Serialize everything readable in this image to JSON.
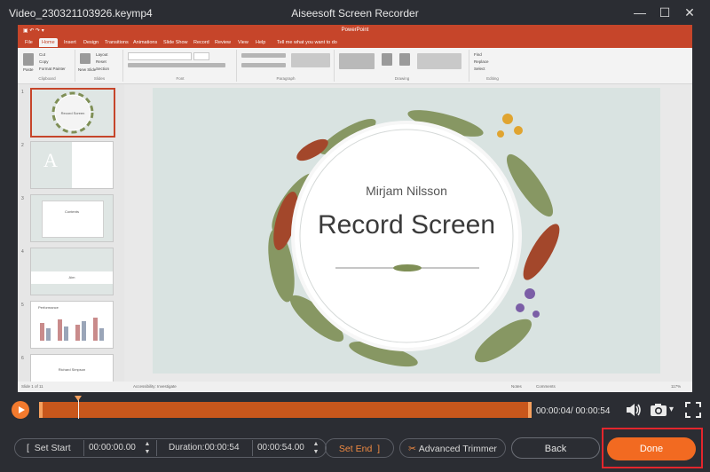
{
  "window": {
    "file_name": "Video_230321103926.keymp4",
    "app_title": "Aiseesoft Screen Recorder",
    "min": "—",
    "max": "☐",
    "close": "✕"
  },
  "ppt": {
    "title": "PowerPoint",
    "tabs": [
      "File",
      "Home",
      "Insert",
      "Design",
      "Transitions",
      "Animations",
      "Slide Show",
      "Record",
      "Review",
      "View",
      "Help",
      "Tell me what you want to do"
    ],
    "groups": [
      "Clipboard",
      "Slides",
      "Font",
      "Paragraph",
      "Drawing",
      "Editing"
    ],
    "clipboard_items": [
      "Paste",
      "Cut",
      "Copy",
      "Format Painter"
    ],
    "slides_items": [
      "New Slide",
      "Layout",
      "Reset",
      "Section"
    ],
    "editing_items": [
      "Find",
      "Replace",
      "Select"
    ],
    "thumbs": [
      {
        "num": "1",
        "text": "Record Screen"
      },
      {
        "num": "2",
        "text": "A"
      },
      {
        "num": "3",
        "text": "Contents"
      },
      {
        "num": "4",
        "text": "Aim"
      },
      {
        "num": "5",
        "text": "Performance"
      },
      {
        "num": "6",
        "text": "Richard Simpson"
      }
    ],
    "slide": {
      "author": "Mirjam Nilsson",
      "title": "Record Screen"
    },
    "status_left": "Slide 1 of 11",
    "status_accessibility": "Accessibility: Investigate",
    "status_notes": "Notes",
    "status_comments": "Comments",
    "status_zoom": "117%"
  },
  "player": {
    "timecode": "00:00:04/ 00:00:54"
  },
  "trimmer": {
    "set_start": "Set Start",
    "start_time": "00:00:00.00",
    "duration": "Duration:00:00:54",
    "end_time": "00:00:54.00",
    "set_end": "Set End",
    "advanced_trimmer": "Advanced Trimmer"
  },
  "actions": {
    "back": "Back",
    "done": "Done"
  },
  "colors": {
    "accent": "#f26a21",
    "highlight": "#e3262d",
    "ppt_brand": "#c6452a"
  }
}
